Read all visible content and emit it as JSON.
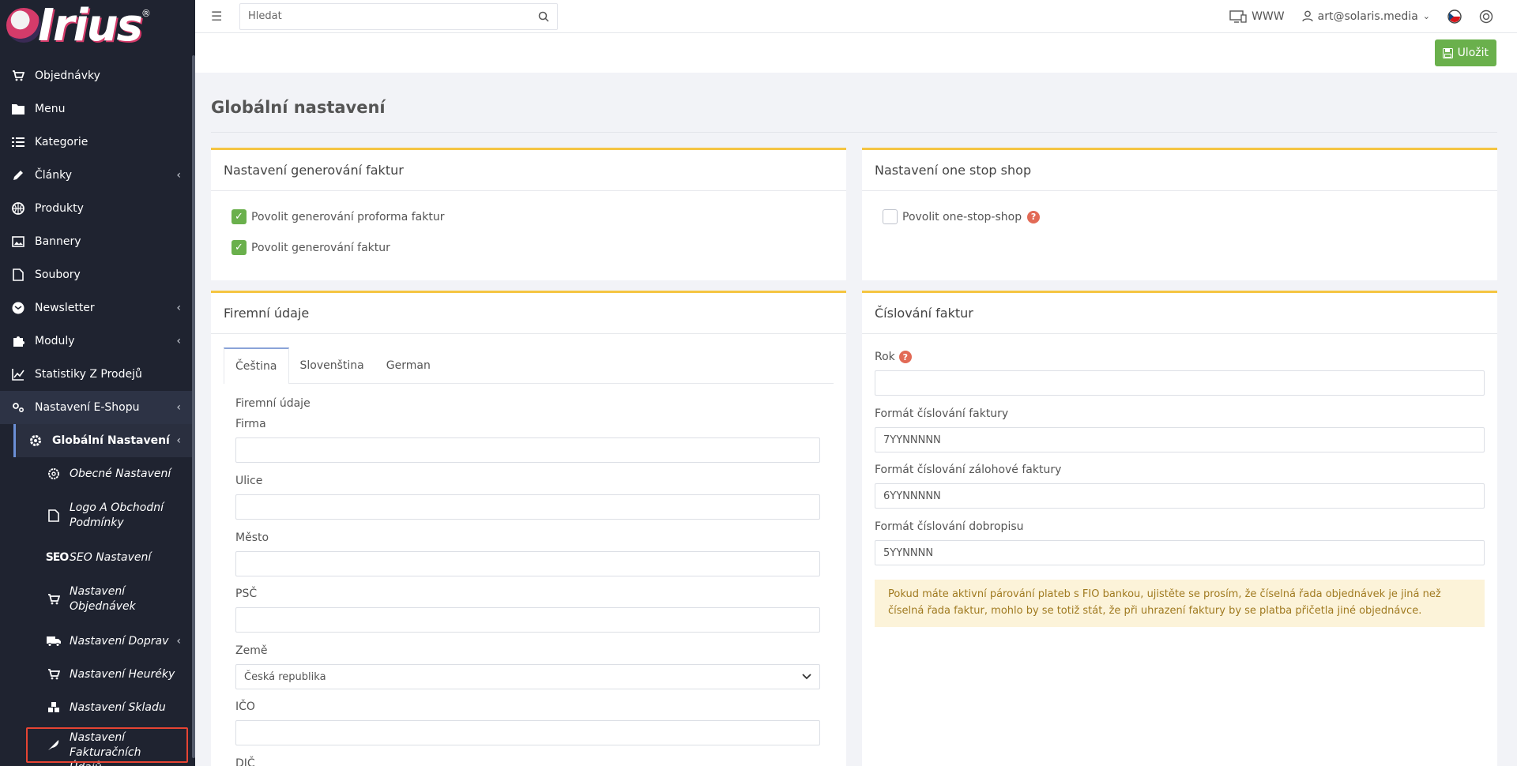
{
  "brand": {
    "name": "Irius",
    "reg": "®"
  },
  "sidebar": {
    "items": [
      {
        "label": "Objednávky",
        "icon": "cart-icon"
      },
      {
        "label": "Menu",
        "icon": "folder-icon"
      },
      {
        "label": "Kategorie",
        "icon": "list-icon"
      },
      {
        "label": "Články",
        "icon": "pencil-icon",
        "chevron": "‹"
      },
      {
        "label": "Produkty",
        "icon": "basketball-icon"
      },
      {
        "label": "Bannery",
        "icon": "image-icon"
      },
      {
        "label": "Soubory",
        "icon": "file-icon"
      },
      {
        "label": "Newsletter",
        "icon": "mail-icon",
        "chevron": "‹"
      },
      {
        "label": "Moduly",
        "icon": "puzzle-icon",
        "chevron": "‹"
      },
      {
        "label": "Statistiky Z Prodejů",
        "icon": "chart-line-icon"
      },
      {
        "label": "Nastavení E-Shopu",
        "icon": "cogs-icon",
        "chevron": "‹"
      }
    ],
    "sub_item": {
      "label": "Globální Nastavení",
      "chevron": "‹"
    },
    "subsub_items": [
      {
        "label": "Obecné Nastavení"
      },
      {
        "label": "Logo A Obchodní Podmínky"
      },
      {
        "label": "SEO Nastavení",
        "icon_text": "SEO"
      },
      {
        "label": "Nastavení Objednávek"
      },
      {
        "label": "Nastavení Doprav",
        "chevron": "‹"
      },
      {
        "label": "Nastavení Heuréky"
      },
      {
        "label": "Nastavení Skladu"
      },
      {
        "label": "Nastavení Fakturačních Údajů"
      }
    ]
  },
  "topbar": {
    "search_placeholder": "Hledat",
    "www_label": "WWW",
    "user_email": "art@solaris.media"
  },
  "toolbar": {
    "save_label": "Uložit"
  },
  "page": {
    "title": "Globální nastavení"
  },
  "invoice_generation": {
    "title": "Nastavení generování faktur",
    "options": [
      {
        "label": "Povolit generování proforma faktur",
        "checked": true
      },
      {
        "label": "Povolit generování faktur",
        "checked": true
      }
    ]
  },
  "one_stop_shop": {
    "title": "Nastavení one stop shop",
    "option": {
      "label": "Povolit one-stop-shop",
      "checked": false
    }
  },
  "company": {
    "title": "Firemní údaje",
    "tabs": [
      "Čeština",
      "Slovenština",
      "German"
    ],
    "section_label": "Firemní údaje",
    "fields": {
      "firma": {
        "label": "Firma",
        "value": ""
      },
      "ulice": {
        "label": "Ulice",
        "value": ""
      },
      "mesto": {
        "label": "Město",
        "value": ""
      },
      "psc": {
        "label": "PSČ",
        "value": ""
      },
      "zeme": {
        "label": "Země",
        "value": "Česká republika"
      },
      "ico": {
        "label": "IČO",
        "value": ""
      },
      "dic": {
        "label": "DIČ"
      }
    }
  },
  "numbering": {
    "title": "Číslování faktur",
    "rok": {
      "label": "Rok",
      "value": ""
    },
    "invoice_format": {
      "label": "Formát číslování faktury",
      "value": "7YYNNNNN"
    },
    "advance_format": {
      "label": "Formát číslování zálohové faktury",
      "value": "6YYNNNNN"
    },
    "credit_format": {
      "label": "Formát číslování dobropisu",
      "value": "5YYNNNN"
    },
    "notice": "Pokud máte aktivní párování plateb s FIO bankou, ujistěte se prosím, že číselná řada objednávek je jiná než číselná řada faktur, mohlo by se totiž stát, že při uhrazení faktury by se platba přičetla jiné objednávce."
  }
}
